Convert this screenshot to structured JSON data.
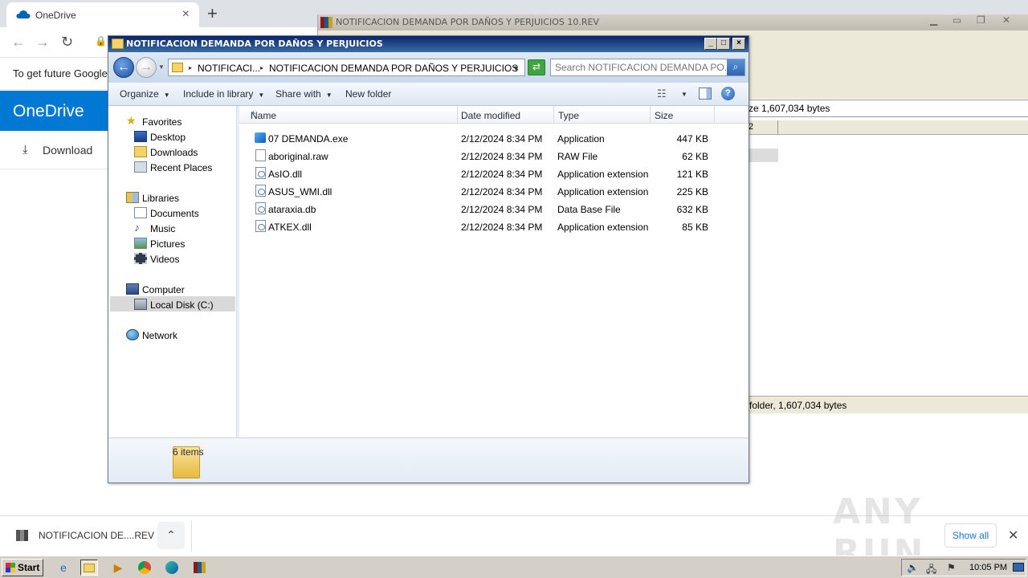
{
  "chrome": {
    "tab_title": "OneDrive",
    "tab_close": "×",
    "new_tab": "+",
    "infobar_text": "To get future Google",
    "onedrive_title": "OneDrive",
    "download_label": "Download"
  },
  "winrar": {
    "title": "NOTIFICACION DEMANDA POR DAÑOS Y PERJUICIOS 10.REV",
    "path_info": "ze 1,607,034 bytes",
    "col_fragment": "2",
    "status": "folder, 1,607,034 bytes"
  },
  "explorer": {
    "title": "NOTIFICACION DEMANDA POR DAÑOS Y PERJUICIOS",
    "breadcrumb": [
      "NOTIFICACI...",
      "NOTIFICACION DEMANDA POR DAÑOS Y PERJUICIOS"
    ],
    "search_placeholder": "Search NOTIFICACION DEMANDA PO...",
    "toolbar": {
      "organize": "Organize",
      "include_in_library": "Include in library",
      "share_with": "Share with",
      "new_folder": "New folder"
    },
    "nav": {
      "favorites": "Favorites",
      "desktop": "Desktop",
      "downloads": "Downloads",
      "recent_places": "Recent Places",
      "libraries": "Libraries",
      "documents": "Documents",
      "music": "Music",
      "pictures": "Pictures",
      "videos": "Videos",
      "computer": "Computer",
      "local_disk": "Local Disk (C:)",
      "network": "Network"
    },
    "columns": {
      "name": "Name",
      "date": "Date modified",
      "type": "Type",
      "size": "Size"
    },
    "files": [
      {
        "name": "07 DEMANDA.exe",
        "date": "2/12/2024 8:34 PM",
        "type": "Application",
        "size": "447 KB",
        "icon": "exe-icon"
      },
      {
        "name": "aboriginal.raw",
        "date": "2/12/2024 8:34 PM",
        "type": "RAW File",
        "size": "62 KB",
        "icon": "file-icon"
      },
      {
        "name": "AsIO.dll",
        "date": "2/12/2024 8:34 PM",
        "type": "Application extension",
        "size": "121 KB",
        "icon": "dll-icon"
      },
      {
        "name": "ASUS_WMI.dll",
        "date": "2/12/2024 8:34 PM",
        "type": "Application extension",
        "size": "225 KB",
        "icon": "dll-icon"
      },
      {
        "name": "ataraxia.db",
        "date": "2/12/2024 8:34 PM",
        "type": "Data Base File",
        "size": "632 KB",
        "icon": "db-icon"
      },
      {
        "name": "ATKEX.dll",
        "date": "2/12/2024 8:34 PM",
        "type": "Application extension",
        "size": "85 KB",
        "icon": "dll-icon"
      }
    ],
    "item_count": "6 items"
  },
  "shelf": {
    "download_name": "NOTIFICACION DE....REV",
    "show_all": "Show all",
    "close": "✕"
  },
  "watermark": "ANY RUN",
  "taskbar": {
    "start": "Start",
    "clock": "10:05 PM"
  }
}
